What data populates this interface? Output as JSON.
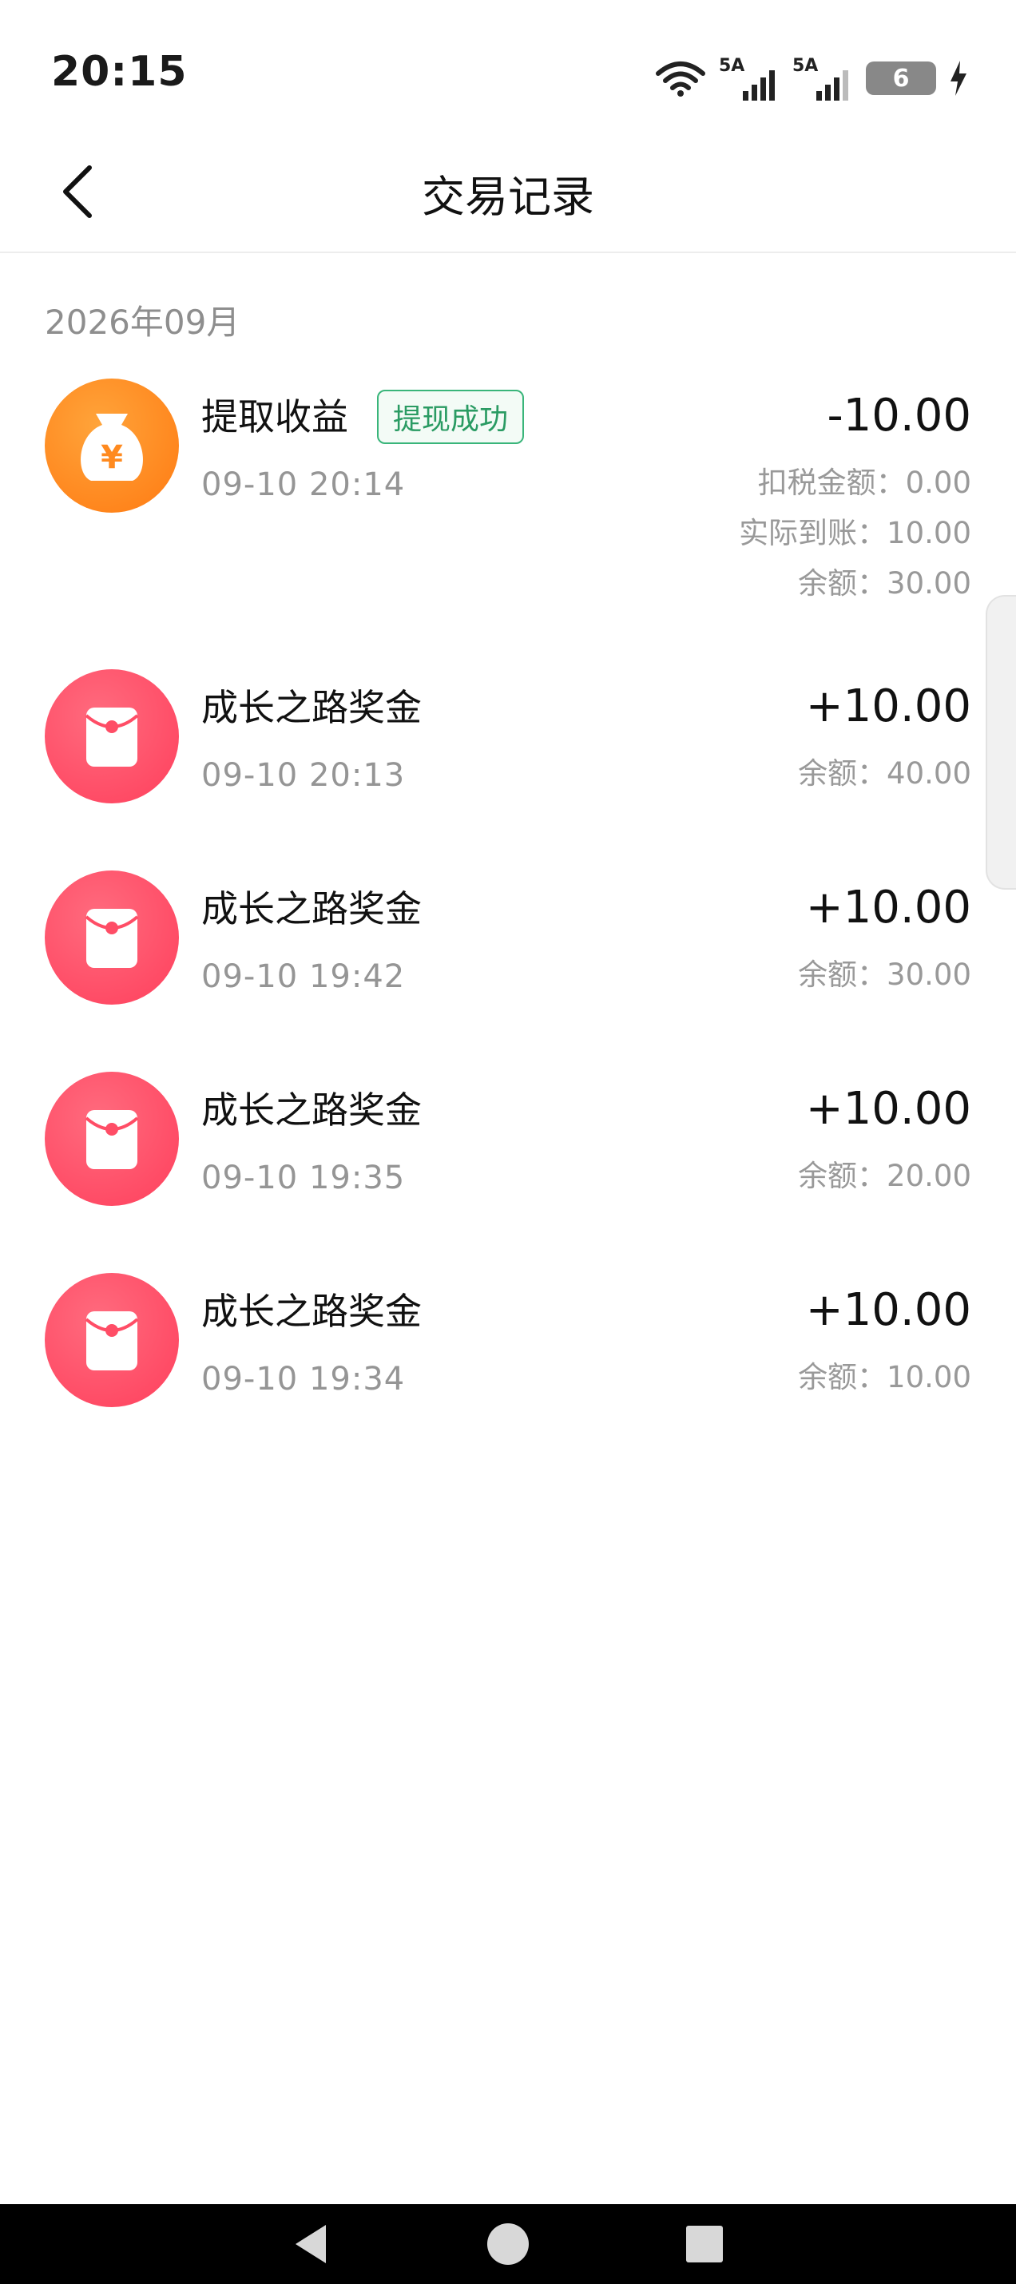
{
  "status_bar": {
    "time": "20:15",
    "signal1_label": "5A",
    "signal2_label": "5A",
    "battery": "6"
  },
  "header": {
    "title": "交易记录"
  },
  "month": "2026年09月",
  "colors": {
    "badge_green": "#2a9b63",
    "icon_orange": "#ff8a1f",
    "icon_red": "#ff4d66"
  },
  "records": [
    {
      "icon": "money-bag-icon",
      "title": "提取收益",
      "badge": "提现成功",
      "time": "09-10 20:14",
      "amount": "-10.00",
      "details": [
        "扣税金额：0.00",
        "实际到账：10.00",
        "余额：30.00"
      ]
    },
    {
      "icon": "red-envelope-icon",
      "title": "成长之路奖金",
      "time": "09-10 20:13",
      "amount": "+10.00",
      "details": [
        "余额：40.00"
      ]
    },
    {
      "icon": "red-envelope-icon",
      "title": "成长之路奖金",
      "time": "09-10 19:42",
      "amount": "+10.00",
      "details": [
        "余额：30.00"
      ]
    },
    {
      "icon": "red-envelope-icon",
      "title": "成长之路奖金",
      "time": "09-10 19:35",
      "amount": "+10.00",
      "details": [
        "余额：20.00"
      ]
    },
    {
      "icon": "red-envelope-icon",
      "title": "成长之路奖金",
      "time": "09-10 19:34",
      "amount": "+10.00",
      "details": [
        "余额：10.00"
      ]
    }
  ]
}
